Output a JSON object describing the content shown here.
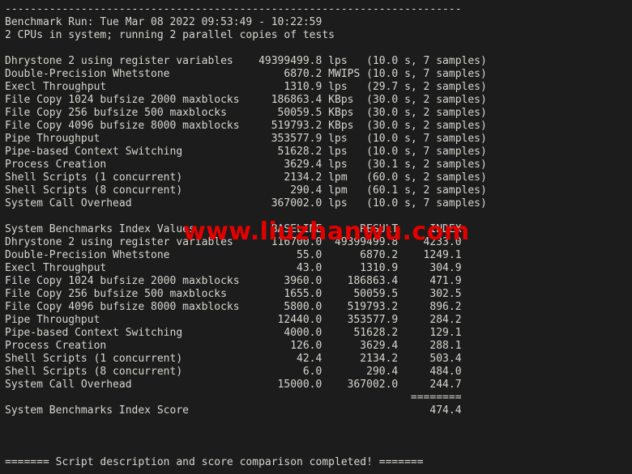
{
  "terminal": {
    "background_color": "#1c1c1c",
    "text_color": "#d6d6d0",
    "watermark_color": "#e50000",
    "watermark_text": "www.liuzhanwu.com",
    "top_rule": "------------------------------------------------------------------------",
    "header": {
      "run_line": "Benchmark Run: Tue Mar 08 2022 09:53:49 - 10:22:59",
      "cpu_line": "2 CPUs in system; running 2 parallel copies of tests"
    },
    "raw_results": {
      "rows": [
        {
          "name": "Dhrystone 2 using register variables",
          "value": "49399499.8",
          "unit": "lps",
          "timing": "(10.0 s, 7 samples)"
        },
        {
          "name": "Double-Precision Whetstone",
          "value": "6870.2",
          "unit": "MWIPS",
          "timing": "(10.0 s, 7 samples)"
        },
        {
          "name": "Execl Throughput",
          "value": "1310.9",
          "unit": "lps",
          "timing": "(29.7 s, 2 samples)"
        },
        {
          "name": "File Copy 1024 bufsize 2000 maxblocks",
          "value": "186863.4",
          "unit": "KBps",
          "timing": "(30.0 s, 2 samples)"
        },
        {
          "name": "File Copy 256 bufsize 500 maxblocks",
          "value": "50059.5",
          "unit": "KBps",
          "timing": "(30.0 s, 2 samples)"
        },
        {
          "name": "File Copy 4096 bufsize 8000 maxblocks",
          "value": "519793.2",
          "unit": "KBps",
          "timing": "(30.0 s, 2 samples)"
        },
        {
          "name": "Pipe Throughput",
          "value": "353577.9",
          "unit": "lps",
          "timing": "(10.0 s, 7 samples)"
        },
        {
          "name": "Pipe-based Context Switching",
          "value": "51628.2",
          "unit": "lps",
          "timing": "(10.0 s, 7 samples)"
        },
        {
          "name": "Process Creation",
          "value": "3629.4",
          "unit": "lps",
          "timing": "(30.1 s, 2 samples)"
        },
        {
          "name": "Shell Scripts (1 concurrent)",
          "value": "2134.2",
          "unit": "lpm",
          "timing": "(60.0 s, 2 samples)"
        },
        {
          "name": "Shell Scripts (8 concurrent)",
          "value": "290.4",
          "unit": "lpm",
          "timing": "(60.1 s, 2 samples)"
        },
        {
          "name": "System Call Overhead",
          "value": "367002.0",
          "unit": "lps",
          "timing": "(10.0 s, 7 samples)"
        }
      ]
    },
    "index_values": {
      "title": "System Benchmarks Index Values",
      "columns": [
        "BASELINE",
        "RESULT",
        "INDEX"
      ],
      "rows": [
        {
          "name": "Dhrystone 2 using register variables",
          "baseline": "116700.0",
          "result": "49399499.8",
          "index": "4233.0"
        },
        {
          "name": "Double-Precision Whetstone",
          "baseline": "55.0",
          "result": "6870.2",
          "index": "1249.1"
        },
        {
          "name": "Execl Throughput",
          "baseline": "43.0",
          "result": "1310.9",
          "index": "304.9"
        },
        {
          "name": "File Copy 1024 bufsize 2000 maxblocks",
          "baseline": "3960.0",
          "result": "186863.4",
          "index": "471.9"
        },
        {
          "name": "File Copy 256 bufsize 500 maxblocks",
          "baseline": "1655.0",
          "result": "50059.5",
          "index": "302.5"
        },
        {
          "name": "File Copy 4096 bufsize 8000 maxblocks",
          "baseline": "5800.0",
          "result": "519793.2",
          "index": "896.2"
        },
        {
          "name": "Pipe Throughput",
          "baseline": "12440.0",
          "result": "353577.9",
          "index": "284.2"
        },
        {
          "name": "Pipe-based Context Switching",
          "baseline": "4000.0",
          "result": "51628.2",
          "index": "129.1"
        },
        {
          "name": "Process Creation",
          "baseline": "126.0",
          "result": "3629.4",
          "index": "288.1"
        },
        {
          "name": "Shell Scripts (1 concurrent)",
          "baseline": "42.4",
          "result": "2134.2",
          "index": "503.4"
        },
        {
          "name": "Shell Scripts (8 concurrent)",
          "baseline": "6.0",
          "result": "290.4",
          "index": "484.0"
        },
        {
          "name": "System Call Overhead",
          "baseline": "15000.0",
          "result": "367002.0",
          "index": "244.7"
        }
      ],
      "score_rule": "========",
      "score_label": "System Benchmarks Index Score",
      "score_value": "474.4"
    },
    "footer": {
      "completion_line": "======= Script description and score comparison completed! ======="
    }
  }
}
